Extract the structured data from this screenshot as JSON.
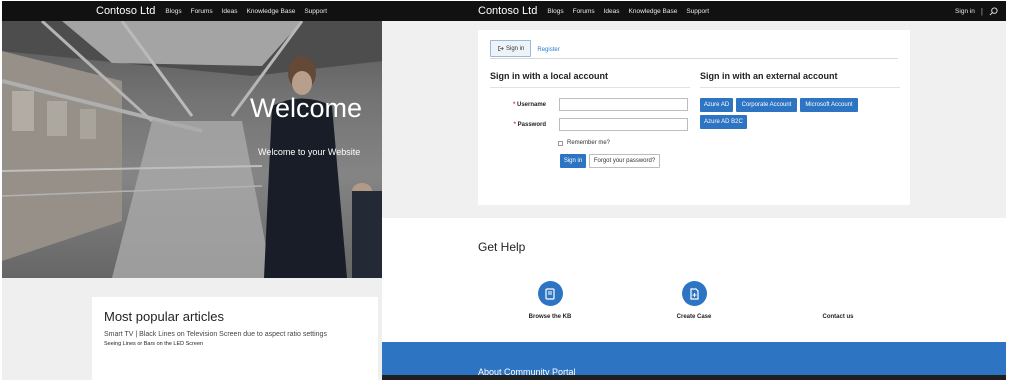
{
  "left_panel": {
    "navbar": {
      "brand": "Contoso Ltd",
      "links": [
        "Blogs",
        "Forums",
        "Ideas",
        "Knowledge Base",
        "Support"
      ]
    },
    "hero": {
      "title": "Welcome",
      "subtitle": "Welcome to your Website"
    },
    "popular_articles": {
      "heading": "Most popular articles",
      "items": [
        "Smart TV | Black Lines on Television Screen due to aspect ratio settings",
        "Seeing Lines or Bars on the LED Screen"
      ]
    }
  },
  "right_panel": {
    "navbar": {
      "brand": "Contoso Ltd",
      "links": [
        "Blogs",
        "Forums",
        "Ideas",
        "Knowledge Base",
        "Support"
      ],
      "sign_in": "Sign in",
      "separator": "|",
      "search_icon": "search-icon"
    },
    "tabs": {
      "sign_in": "Sign in",
      "register": "Register"
    },
    "local_account": {
      "heading": "Sign in with a local account",
      "required_mark": "*",
      "username_label": "Username",
      "password_label": "Password",
      "username_value": "",
      "password_value": "",
      "remember_me": "Remember me?",
      "sign_in_button": "Sign in",
      "forgot_button": "Forgot your password?"
    },
    "external_account": {
      "heading": "Sign in with an external account",
      "providers": [
        "Azure AD",
        "Corporate Account",
        "Microsoft Account",
        "Azure AD B2C"
      ]
    },
    "get_help": {
      "title": "Get Help",
      "items": [
        {
          "label": "Browse the KB",
          "icon": "book-icon"
        },
        {
          "label": "Create Case",
          "icon": "create-case-icon"
        },
        {
          "label": "Contact us",
          "icon": ""
        }
      ]
    },
    "about": {
      "title": "About Community Portal"
    },
    "colors": {
      "primary": "#2d74c3",
      "navbar": "#111111",
      "required": "#d33333"
    }
  }
}
